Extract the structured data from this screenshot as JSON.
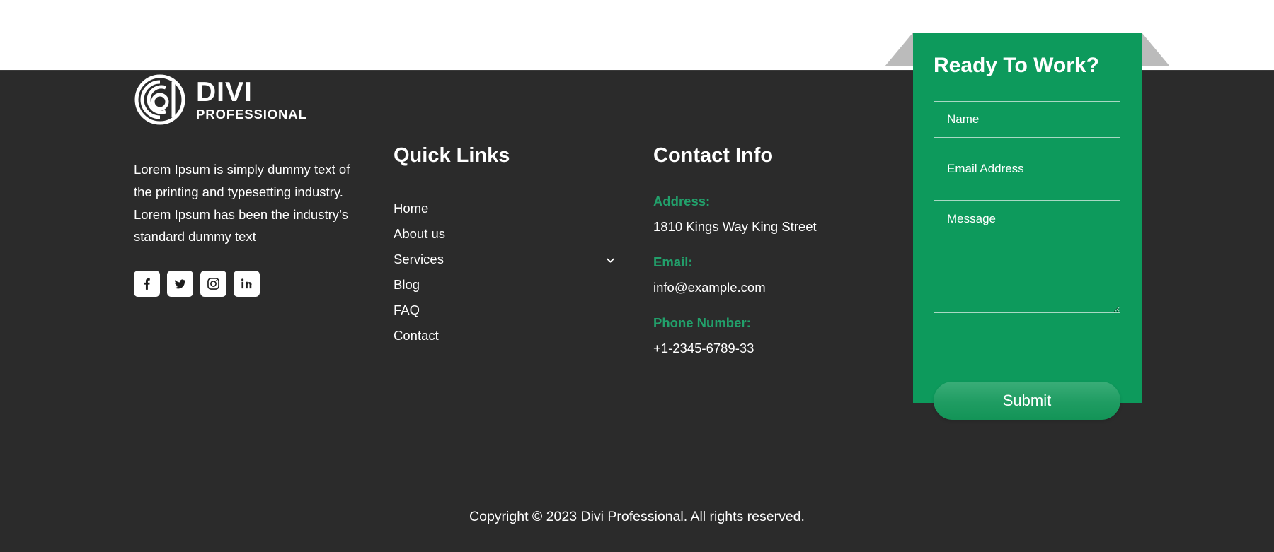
{
  "brand": {
    "logo_icon": "divi-spiral-logo-icon",
    "name_top": "DIVI",
    "name_sub": "PROFESSIONAL",
    "description": "Lorem Ipsum is simply dummy text of the printing and typesetting industry. Lorem Ipsum has been the industry’s standard dummy text",
    "social": [
      {
        "name": "facebook-icon",
        "label": "Facebook"
      },
      {
        "name": "twitter-icon",
        "label": "Twitter"
      },
      {
        "name": "instagram-icon",
        "label": "Instagram"
      },
      {
        "name": "linkedin-icon",
        "label": "LinkedIn"
      }
    ]
  },
  "quick_links": {
    "title": "Quick Links",
    "items": [
      {
        "label": "Home",
        "has_submenu": false
      },
      {
        "label": "About us",
        "has_submenu": false
      },
      {
        "label": "Services",
        "has_submenu": true
      },
      {
        "label": "Blog",
        "has_submenu": false
      },
      {
        "label": "FAQ",
        "has_submenu": false
      },
      {
        "label": "Contact",
        "has_submenu": false
      }
    ]
  },
  "contact_info": {
    "title": "Contact Info",
    "address_label": "Address:",
    "address_value": "1810 Kings Way King Street",
    "email_label": "Email:",
    "email_value": "info@example.com",
    "phone_label": "Phone Number:",
    "phone_value": "+1-2345-6789-33"
  },
  "form": {
    "title": "Ready To Work?",
    "name_placeholder": "Name",
    "name_value": "",
    "email_placeholder": "Email Address",
    "email_value": "",
    "message_placeholder": "Message",
    "message_value": "",
    "submit_label": "Submit"
  },
  "footer": {
    "copyright": "Copyright © 2023 Divi Professional. All rights reserved."
  },
  "colors": {
    "background_dark": "#2b2b2b",
    "card_green": "#0d9a5c",
    "accent_green": "#22a06b",
    "wing_gray": "#bbbbbb",
    "text_white": "#ffffff"
  }
}
